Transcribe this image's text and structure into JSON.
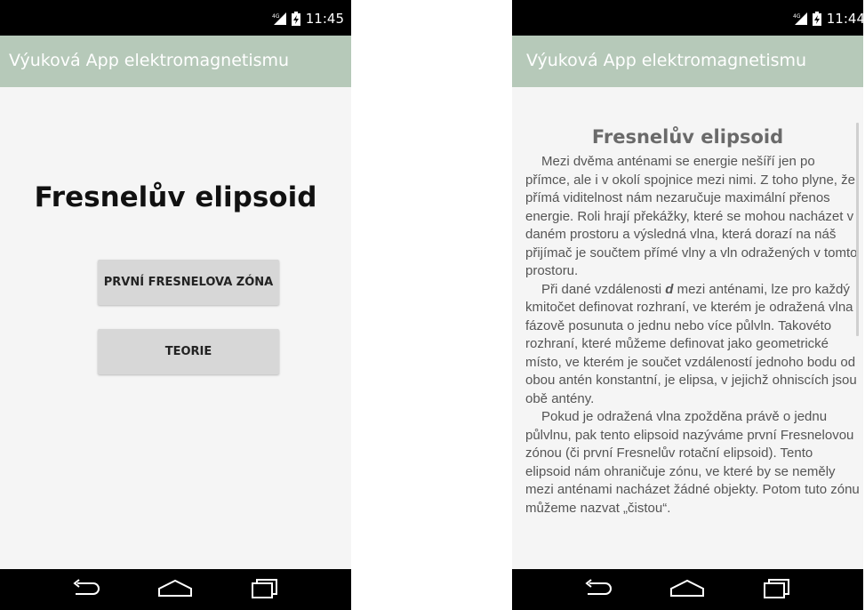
{
  "left_screen": {
    "status": {
      "network": "4G",
      "time": "11:45"
    },
    "app_title": "Výuková App elektromagnetismu",
    "main_title": "Fresnelův elipsoid",
    "buttons": {
      "first_zone": "PRVNÍ FRESNELOVA ZÓNA",
      "theory": "TEORIE"
    }
  },
  "right_screen": {
    "status": {
      "network": "4G",
      "time": "11:44"
    },
    "app_title": "Výuková App elektromagnetismu",
    "title": "Fresnelův elipsoid",
    "p1": "Mezi dvěma anténami se energie nešíří jen po přímce, ale i v okolí spojnice mezi nimi. Z toho plyne, že přímá viditelnost nám nezaručuje maximální přenos energie. Roli hrají překážky, které se mohou nacházet v daném prostoru a výsledná vlna, která dorazí na náš přijímač je součtem přímé vlny a vln odražených v tomto prostoru.",
    "p2_before": "Při dané vzdálenosti ",
    "p2_var": "d",
    "p2_after": " mezi anténami, lze pro každý kmitočet definovat rozhraní, ve kterém je odražená vlna fázově posunuta o jednu nebo více půlvln. Takovéto rozhraní, které můžeme definovat jako geometrické místo, ve kterém je součet vzdáleností jednoho bodu od obou antén konstantní, je elipsa, v jejichž ohniscích jsou obě antény.",
    "p3": "Pokud je odražená vlna zpožděna právě o jednu půlvlnu, pak tento elipsoid nazýváme první Fresnelovou zónou (či první Fresnelův rotační elipsoid). Tento elipsoid nám ohraničuje zónu, ve které by se neměly mezi anténami nacházet žádné objekty. Potom tuto zónu můžeme nazvat „čistou“."
  },
  "colors": {
    "app_bar": "#b6c9b9",
    "status_bar": "#000000",
    "nav_bar": "#000000",
    "button": "#d7d7d7"
  },
  "icons": [
    "signal-4g-icon",
    "battery-icon",
    "back-icon",
    "home-icon",
    "recent-apps-icon"
  ]
}
